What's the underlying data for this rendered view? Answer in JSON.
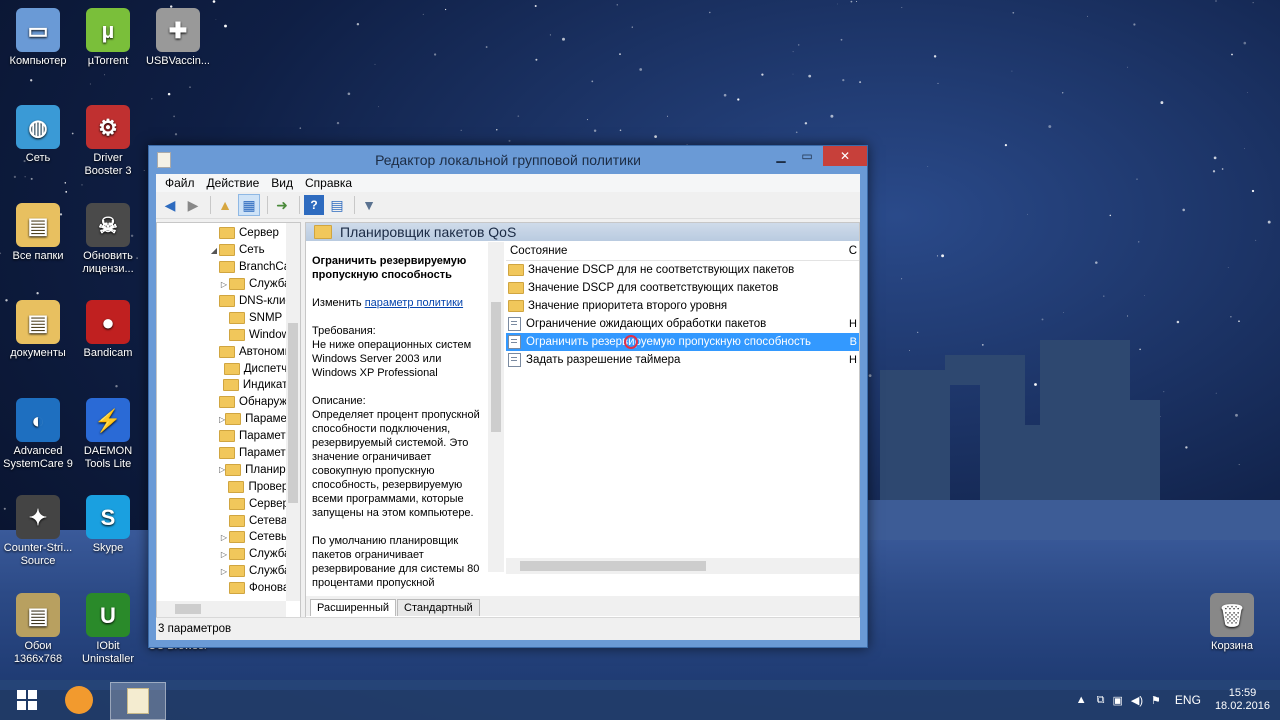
{
  "desktop": {
    "icons": [
      {
        "label": "Компьютер",
        "icon": "computer-icon"
      },
      {
        "label": "µTorrent",
        "icon": "utorrent-icon"
      },
      {
        "label": "USBVaccin...",
        "icon": "usb-vaccine-icon"
      },
      {
        "label": "Сеть",
        "icon": "network-icon"
      },
      {
        "label": "Driver\nBooster 3",
        "icon": "driver-booster-icon"
      },
      {
        "label": "Все папки",
        "icon": "folder-icon"
      },
      {
        "label": "Обновить\nлицензи...",
        "icon": "update-license-icon"
      },
      {
        "label": "документы",
        "icon": "folder-icon"
      },
      {
        "label": "Bandicam",
        "icon": "bandicam-icon"
      },
      {
        "label": "Advanced\nSystemCare 9",
        "icon": "systemcare-icon"
      },
      {
        "label": "DAEMON\nTools Lite",
        "icon": "daemon-tools-icon"
      },
      {
        "label": "Counter-Stri...\nSource",
        "icon": "counter-strike-icon"
      },
      {
        "label": "Skype",
        "icon": "skype-icon"
      },
      {
        "label": "Обои\n1366x768",
        "icon": "folder-icon"
      },
      {
        "label": "IObit\nUninstaller",
        "icon": "iobit-uninstaller-icon"
      },
      {
        "label": "Корзина",
        "icon": "recycle-bin-icon"
      }
    ],
    "partial_label": "UC Browser"
  },
  "window": {
    "title": "Редактор локальной групповой политики",
    "menu": [
      "Файл",
      "Действие",
      "Вид",
      "Справка"
    ],
    "tree": [
      {
        "label": "Сервер",
        "arrow": ""
      },
      {
        "label": "Сеть",
        "arrow": "◢"
      },
      {
        "label": "BranchCache",
        "arrow": ""
      },
      {
        "label": "Служба",
        "arrow": "▷"
      },
      {
        "label": "DNS-клиент",
        "arrow": ""
      },
      {
        "label": "SNMP",
        "arrow": ""
      },
      {
        "label": "Windows",
        "arrow": ""
      },
      {
        "label": "Автономные",
        "arrow": ""
      },
      {
        "label": "Диспетчер",
        "arrow": ""
      },
      {
        "label": "Индикатор",
        "arrow": ""
      },
      {
        "label": "Обнаружение",
        "arrow": ""
      },
      {
        "label": "Параметры",
        "arrow": "▷"
      },
      {
        "label": "Параметры",
        "arrow": ""
      },
      {
        "label": "Параметры",
        "arrow": ""
      },
      {
        "label": "Планировщик",
        "arrow": "▷"
      },
      {
        "label": "Проверка",
        "arrow": ""
      },
      {
        "label": "Сервер",
        "arrow": ""
      },
      {
        "label": "Сетевая",
        "arrow": ""
      },
      {
        "label": "Сетевые",
        "arrow": "▷"
      },
      {
        "label": "Служба",
        "arrow": "▷"
      },
      {
        "label": "Служба",
        "arrow": "▷"
      },
      {
        "label": "Фоновая",
        "arrow": ""
      }
    ],
    "right_header": "Планировщик пакетов QoS",
    "description": {
      "title": "Ограничить резервируемую пропускную способность",
      "edit_prefix": "Изменить",
      "edit_link": "параметр политики",
      "requirements_label": "Требования:",
      "requirements": "Не ниже операционных систем Windows Server 2003 или Windows XP Professional",
      "description_label": "Описание:",
      "description": "Определяет процент пропускной способности подключения, резервируемый системой. Это значение ограничивает совокупную пропускную способность, резервируемую всеми программами, которые запущены на этом компьютере.",
      "default_text": "По умолчанию планировщик пакетов ограничивает резервирование для системы 80 процентами пропускной"
    },
    "list_header": {
      "state": "Состояние",
      "col2": "С"
    },
    "list": [
      {
        "label": "Значение DSCP для не соответствующих пакетов",
        "type": "folder",
        "trail": ""
      },
      {
        "label": "Значение DSCP для соответствующих пакетов",
        "type": "folder",
        "trail": ""
      },
      {
        "label": "Значение приоритета второго уровня",
        "type": "folder",
        "trail": ""
      },
      {
        "label": "Ограничение ожидающих обработки пакетов",
        "type": "setting",
        "trail": "Н"
      },
      {
        "label": "Ограничить резервируемую пропускную способность",
        "type": "setting",
        "trail": "В",
        "selected": true
      },
      {
        "label": "Задать разрешение таймера",
        "type": "setting",
        "trail": "Н"
      }
    ],
    "tabs": [
      "Расширенный",
      "Стандартный"
    ],
    "status": "3 параметров"
  },
  "taskbar": {
    "lang": "ENG",
    "time": "15:59",
    "date": "18.02.2016",
    "accent": "#3399ff"
  }
}
